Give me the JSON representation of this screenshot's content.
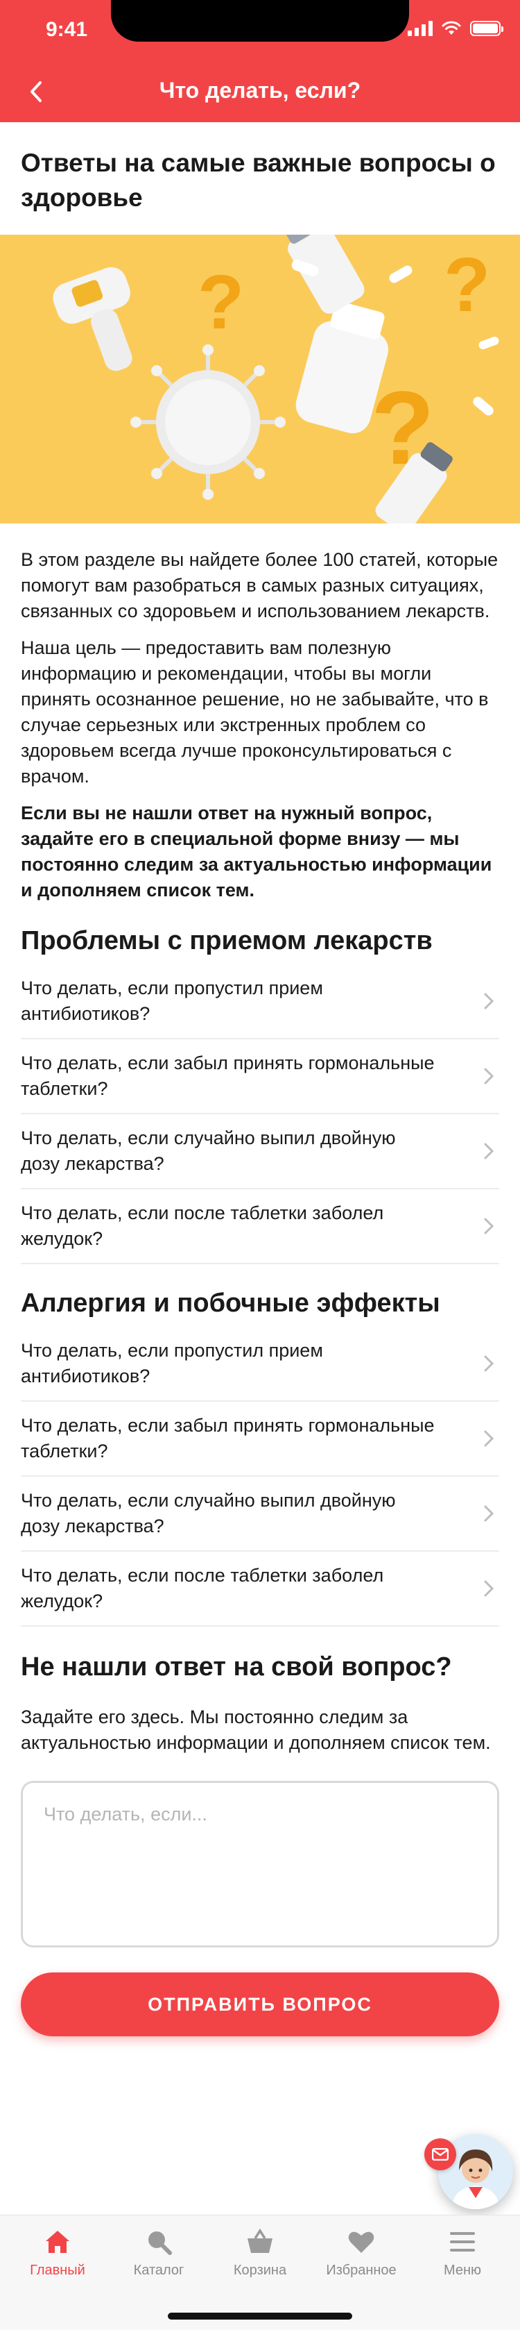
{
  "status_bar": {
    "time": "9:41"
  },
  "header": {
    "title": "Что делать, если?"
  },
  "page": {
    "title": "Ответы на самые важные вопросы о здоровье"
  },
  "intro": {
    "p1": "В этом разделе вы найдете более 100 статей, которые помогут вам разобраться в самых разных ситуациях, связанных со здоровьем и использованием лекарств.",
    "p2": "Наша цель — предоставить вам полезную информацию и рекомендации, чтобы вы могли принять осознанное решение, но не забывайте, что в случае серьезных или экстренных проблем со здоровьем всегда лучше проконсультироваться с врачом.",
    "p3": "Если вы не нашли ответ на нужный вопрос, задайте его в специальной форме внизу — мы постоянно следим за актуальностью информации и дополняем список тем."
  },
  "sections": [
    {
      "title": "Проблемы с приемом лекарств",
      "items": [
        "Что делать, если пропустил прием антибиотиков?",
        "Что делать, если забыл принять гормональные таблетки?",
        "Что делать, если случайно выпил двойную дозу лекарства?",
        "Что делать, если после таблетки заболел желудок?"
      ]
    },
    {
      "title": "Аллергия и побочные эффекты",
      "items": [
        "Что делать, если пропустил прием антибиотиков?",
        "Что делать, если забыл принять гормональные таблетки?",
        "Что делать, если случайно выпил двойную дозу лекарства?",
        "Что делать, если после таблетки заболел желудок?"
      ]
    }
  ],
  "ask": {
    "title": "Не нашли ответ на свой вопрос?",
    "text": "Задайте его здесь. Мы постоянно следим за актуальностью информации и дополняем список тем.",
    "placeholder": "Что делать, если...",
    "value": "",
    "submit_label": "ОТПРАВИТЬ ВОПРОС"
  },
  "tabbar": {
    "items": [
      {
        "label": "Главный",
        "icon": "home-icon",
        "active": true
      },
      {
        "label": "Каталог",
        "icon": "search-icon",
        "active": false
      },
      {
        "label": "Корзина",
        "icon": "basket-icon",
        "active": false
      },
      {
        "label": "Избранное",
        "icon": "heart-icon",
        "active": false
      },
      {
        "label": "Меню",
        "icon": "menu-icon",
        "active": false
      }
    ]
  },
  "colors": {
    "accent": "#f24447",
    "hero_background": "#fbcb5a",
    "tab_inactive": "#8a8a8a"
  }
}
